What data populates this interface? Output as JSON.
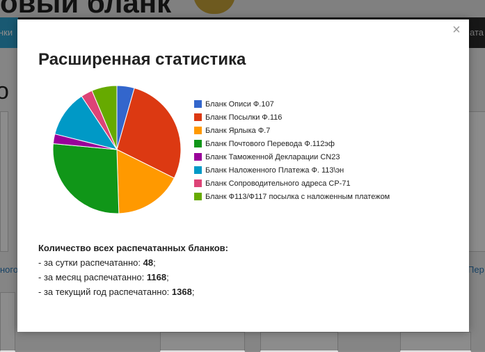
{
  "background": {
    "site_title": "овый бланк",
    "nav_left": "нки",
    "nav_right": "ата",
    "big_left": "о",
    "link_left": "ного",
    "link_right": "Пер"
  },
  "modal": {
    "title": "Расширенная статистика",
    "close_label": "×"
  },
  "chart_data": {
    "type": "pie",
    "title": "",
    "slices": [
      {
        "label": "Бланк Описи Ф.107",
        "value": 4.5,
        "color": "#3366cc"
      },
      {
        "label": "Бланк Посылки Ф.116",
        "value": 28.5,
        "color": "#dc3912"
      },
      {
        "label": "Бланк Ярлыка Ф.7",
        "value": 17.5,
        "color": "#ff9900"
      },
      {
        "label": "Бланк Почтового Перевода Ф.112эф",
        "value": 27.5,
        "color": "#109618"
      },
      {
        "label": "Бланк Таможенной Декларации CN23",
        "value": 2.5,
        "color": "#990099"
      },
      {
        "label": "Бланк Наложенного Платежа Ф. 113\\эн",
        "value": 12.0,
        "color": "#0099c6"
      },
      {
        "label": "Бланк Сопроводительного адреса CP-71",
        "value": 3.0,
        "color": "#dd4477"
      },
      {
        "label": "Бланк Ф113/Ф117 посылка с наложенным платежом",
        "value": 6.5,
        "color": "#66aa00"
      }
    ],
    "legend_position": "right"
  },
  "stats": {
    "heading": "Количество всех распечатанных бланков:",
    "day_prefix": "- за сутки распечатанно: ",
    "day_value": "48",
    "month_prefix": "- за месяц распечатанно: ",
    "month_value": "1168",
    "year_prefix": "- за текущий год распечатанно: ",
    "year_value": "1368",
    "suffix": ";"
  }
}
